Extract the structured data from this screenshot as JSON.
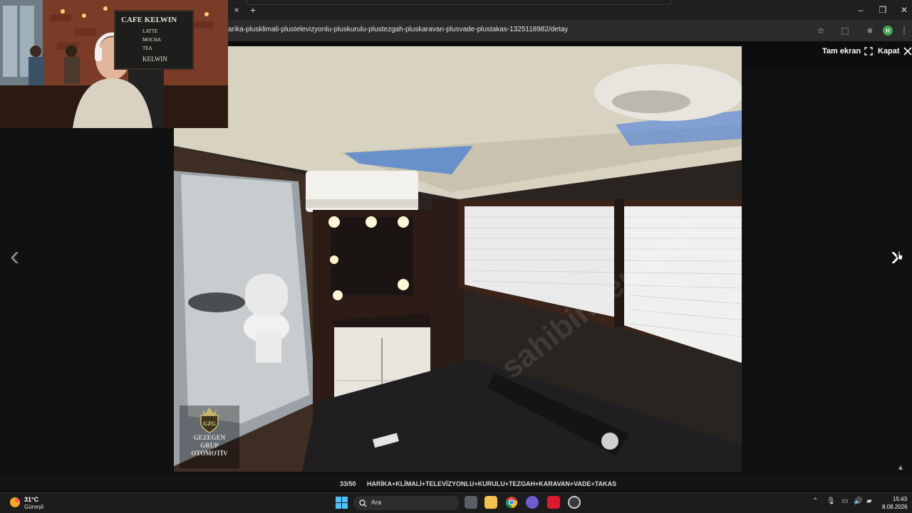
{
  "browser": {
    "close_tab": "×",
    "new_tab": "+",
    "url": "arika-plusklimali-plustelevizyonlu-pluskurulu-plustezgah-pluskaravan-plusvade-plustakas-1325118982/detay",
    "profile_initial": "H",
    "win_min": "–",
    "win_max": "❐",
    "win_close": "✕",
    "bookmark": "☆",
    "extensions": "⬚",
    "media": "≡",
    "menu": "⋮"
  },
  "viewer": {
    "fullscreen_label": "Tam ekran",
    "close_label": "Kapat",
    "prev": "‹",
    "next": "›",
    "counter": "33/50",
    "title": "HARİKA+KLİMALİ+TELEVİZYONLU+KURULU+TEZGAH+KARAVAN+VADE+TAKAS",
    "scroll_top": "▲",
    "watermark": "sahibinden.com",
    "logo": {
      "monogram": "GZG",
      "line1": "GEZEGEN",
      "line2": "GRUP",
      "line3": "OTOMOTİV"
    }
  },
  "webcam": {
    "sign_title": "CAFE KELWIN",
    "sign_lines": [
      "LATTE",
      "MOCHA",
      "TEA",
      "KELWIN"
    ]
  },
  "taskbar": {
    "temperature": "31°C",
    "weather": "Güneşli",
    "search_label": "Ara",
    "time": "15:43",
    "date": "8.08.2026"
  }
}
